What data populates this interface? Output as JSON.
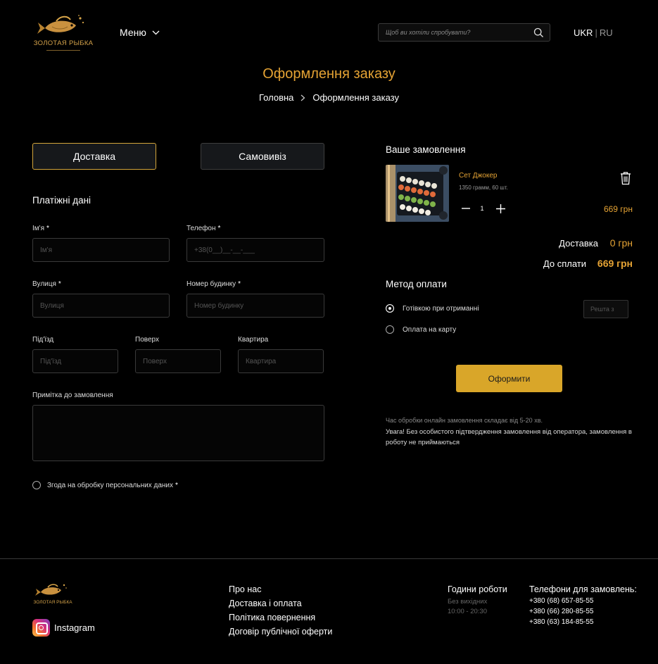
{
  "header": {
    "logo_text": "ЗОЛОТАЯ РЫБКА",
    "menu_label": "Меню",
    "search_placeholder": "Щоб ви хотіли спробувати?",
    "lang_active": "UKR",
    "lang_separator": "|",
    "lang_other": "RU"
  },
  "page": {
    "title": "Оформлення заказу",
    "breadcrumb": [
      "Головна",
      "Оформлення заказу"
    ]
  },
  "delivery_tabs": {
    "delivery": "Доставка",
    "pickup": "Самовивіз",
    "selected": "delivery"
  },
  "form": {
    "section_title": "Платіжні дані",
    "name_label": "Ім'я",
    "name_placeholder": "Ім'я",
    "phone_label": "Телефон",
    "phone_placeholder": "+38(0__)__-__-___",
    "street_label": "Вулиця",
    "street_placeholder": "Вулиця",
    "house_label": "Номер будинку",
    "house_placeholder": "Номер будинку",
    "entrance_label": "Під'їзд",
    "entrance_placeholder": "Під'їзд",
    "floor_label": "Поверх",
    "floor_placeholder": "Поверх",
    "apartment_label": "Квартира",
    "apartment_placeholder": "Квартира",
    "note_label": "Примітка до замовлення",
    "consent_label": "Згода на обробку персональних даних",
    "required_mark": "*"
  },
  "order": {
    "title": "Ваше замовлення",
    "item": {
      "name": "Сет Джокер",
      "meta": "1350 грамм, 60 шт.",
      "quantity": "1",
      "price": "669 грн"
    },
    "delivery_label": "Доставка",
    "delivery_value": "0 грн",
    "total_label": "До сплати",
    "total_value": "669 грн"
  },
  "payment": {
    "title": "Метод оплати",
    "options": [
      "Готівкою при отриманні",
      "Оплата на карту"
    ],
    "selected_index": 0,
    "change_placeholder": "Решта з"
  },
  "submit_label": "Оформити",
  "notes": {
    "processing": "Час обробки онлайн замовлення складає від 5-20 хв.",
    "warning": "Увага! Без особистого підтвердження замовлення від оператора, замовлення в роботу не приймаються"
  },
  "footer": {
    "logo_text": "ЗОЛОТАЯ РЫБКА",
    "instagram": "Instagram",
    "links": [
      "Про нас",
      "Доставка і оплата",
      "Політика повернення",
      "Договір публічної оферти"
    ],
    "hours_title": "Години роботи",
    "hours_days": "Без вихідних",
    "hours_time": "10:00 - 20:30",
    "phones_title": "Телефони для замовлень:",
    "phones": [
      "+380 (68) 657-85-55",
      "+380 (66) 280-85-55",
      "+380 (63) 184-85-55"
    ]
  },
  "colors": {
    "accent": "#e5a334",
    "button": "#d9a629",
    "background": "#000000"
  }
}
